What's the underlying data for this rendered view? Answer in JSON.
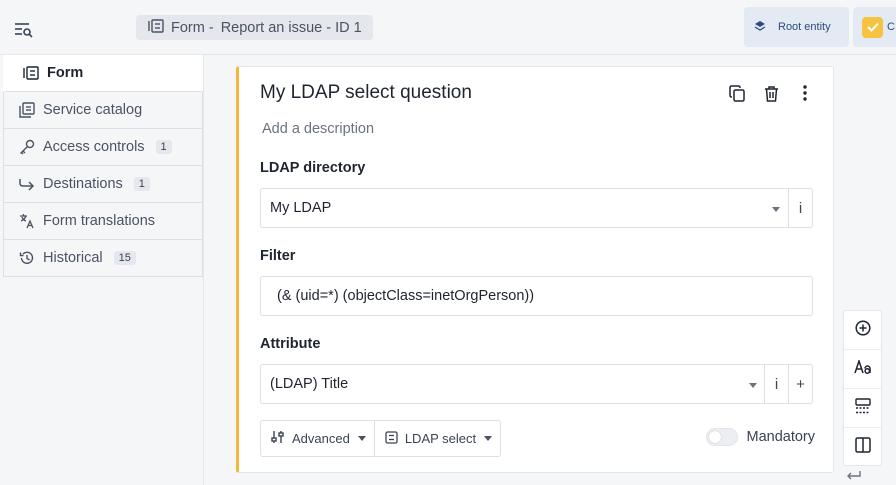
{
  "header": {
    "breadcrumb_prefix": "Form -",
    "breadcrumb_title": "Report an issue - ID 1",
    "entity_button": "Root entity",
    "second_button": "C"
  },
  "tabs": [
    {
      "label": "Form",
      "icon": "form-icon",
      "badge": null
    },
    {
      "label": "Service catalog",
      "icon": "catalog-icon",
      "badge": null
    },
    {
      "label": "Access controls",
      "icon": "key-icon",
      "badge": "1"
    },
    {
      "label": "Destinations",
      "icon": "arrow-forward-icon",
      "badge": "1"
    },
    {
      "label": "Form translations",
      "icon": "translate-icon",
      "badge": null
    },
    {
      "label": "Historical",
      "icon": "history-icon",
      "badge": "15"
    }
  ],
  "question": {
    "title": "My LDAP select question",
    "description_placeholder": "Add a description",
    "ldap_label": "LDAP directory",
    "ldap_value": "My LDAP",
    "filter_label": "Filter",
    "filter_value": "(& (uid=*) (objectClass=inetOrgPerson))",
    "attribute_label": "Attribute",
    "attribute_value": "(LDAP) Title",
    "advanced_label": "Advanced",
    "type_label": "LDAP select",
    "mandatory_label": "Mandatory",
    "info_glyph": "i",
    "plus_glyph": "+"
  },
  "colors": {
    "accent": "#f3b83a",
    "badge_bg": "#e4e7ec",
    "entity_bg": "#e3eaf3"
  }
}
